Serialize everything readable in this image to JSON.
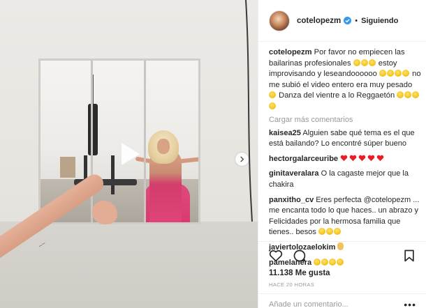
{
  "post": {
    "username": "cotelopezm",
    "follow_status": "Siguiendo",
    "separator": "•"
  },
  "caption": {
    "username": "cotelopezm",
    "text1": "Por favor no empiecen las bailarinas profesionales",
    "text2": "estoy improvisando y leseandoooooo",
    "text3": "no me subió el video entero era muy pesado",
    "text4": "Danza del vientre a lo Reggaetón"
  },
  "load_more": "Cargar más comentarios",
  "comments": [
    {
      "user": "kaisea25",
      "text": "Alguien sabe qué tema es el que está bailando? Lo encontré súper bueno"
    },
    {
      "user": "hectorgalarceuribe",
      "text": ""
    },
    {
      "user": "ginitaveralara",
      "text": "O la cagaste mejor que la chakira"
    },
    {
      "user": "panxitho_cv",
      "text": "Eres perfecta @cotelopezm ... me encanta todo lo que haces.. un abrazo y Felicidades por la hermosa familia que tienes.. besos"
    },
    {
      "user": "javiertolozaelokim",
      "text": ""
    },
    {
      "user": "pamelanera",
      "text": ""
    }
  ],
  "likes": "11.138 Me gusta",
  "timestamp": "HACE 20 HORAS",
  "add_comment_placeholder": "Añade un comentario...",
  "more_glyph": "•••",
  "icons": {
    "like": "heart-outline-icon",
    "comment": "comment-bubble-icon",
    "save": "bookmark-icon",
    "verified": "verified-badge-icon",
    "play": "play-icon",
    "next": "chevron-right-icon"
  },
  "colors": {
    "verified": "#3897f0",
    "heart_emoji": "#ed1c24",
    "muted": "#999999",
    "text": "#262626"
  }
}
